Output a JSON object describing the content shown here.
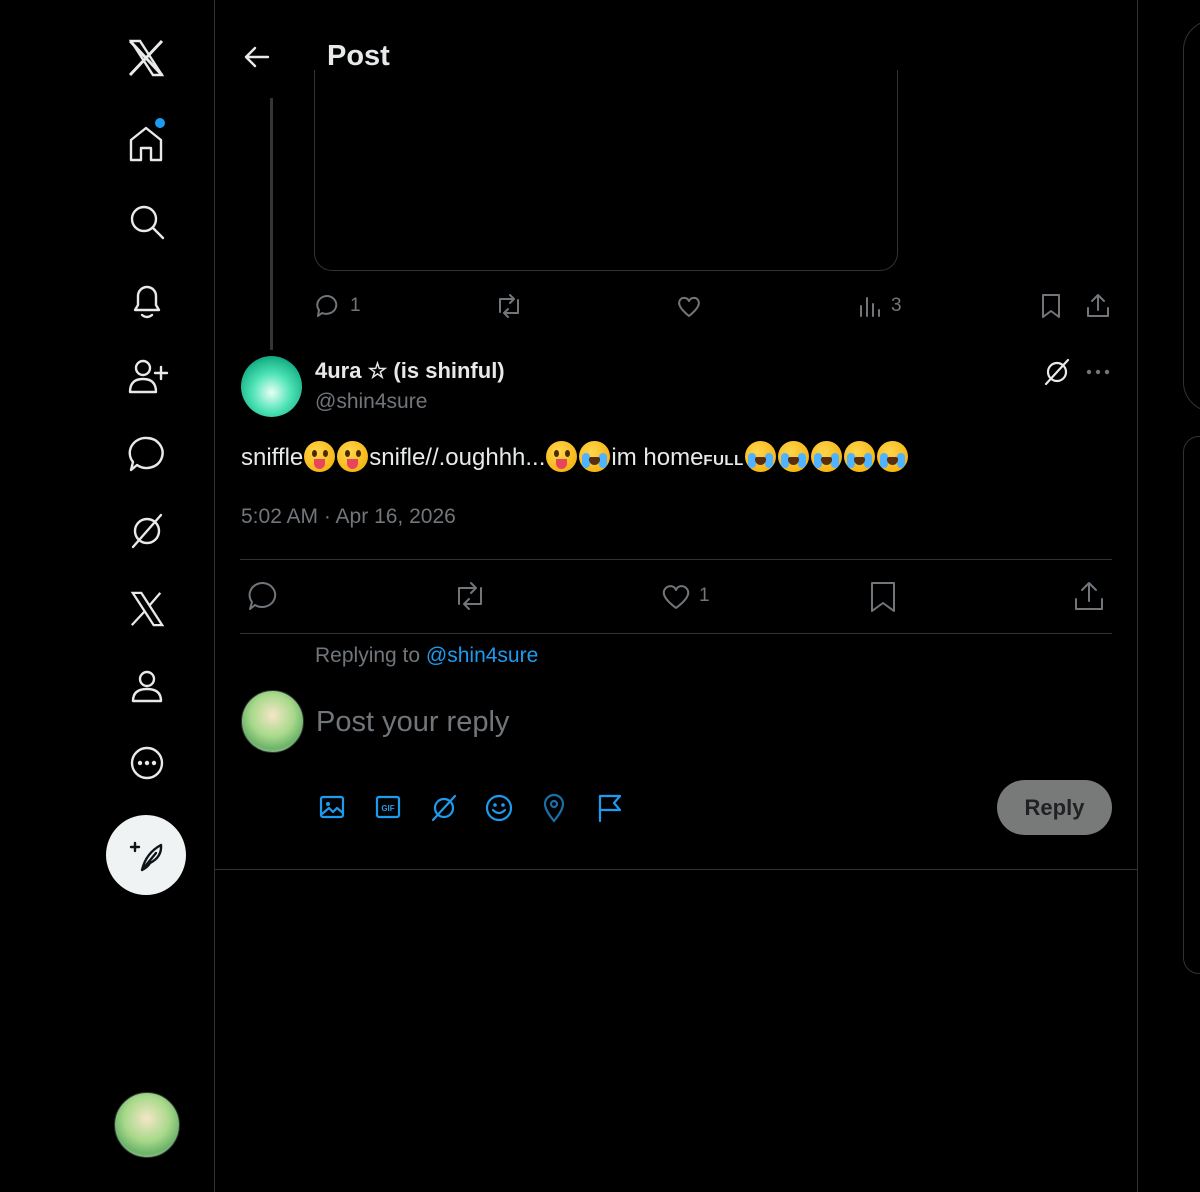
{
  "header": {
    "title": "Post"
  },
  "quoted_post": {
    "stats": {
      "replies": "1",
      "views": "3"
    }
  },
  "post": {
    "author_name": "4ura ☆ (is shinful)",
    "handle": "@shin4sure",
    "text_parts": {
      "p1": "sniffle",
      "p2": "snifle//.oughhh...",
      "p3": "im home",
      "p4": "FULL"
    },
    "timestamp": "5:02 AM · Apr 16, 2026",
    "stats": {
      "likes": "1"
    }
  },
  "reply": {
    "replying_to_label": "Replying to",
    "replying_to_handle": "@shin4sure",
    "placeholder": "Post your reply",
    "button_label": "Reply"
  },
  "colors": {
    "background": "#000000",
    "text": "#e7e9ea",
    "secondary_text": "#71767b",
    "accent": "#1d9bf0",
    "notification_dot": "#1d9bf0"
  },
  "icons": {
    "sidebar": [
      "x-logo-icon",
      "home-icon",
      "search-icon",
      "notifications-icon",
      "follow-icon",
      "chat-icon",
      "grok-icon",
      "premium-icon",
      "profile-icon",
      "more-icon",
      "compose-icon"
    ],
    "composer": [
      "media-icon",
      "gif-icon",
      "grok-icon",
      "emoji-icon",
      "location-icon",
      "flag-icon"
    ]
  }
}
